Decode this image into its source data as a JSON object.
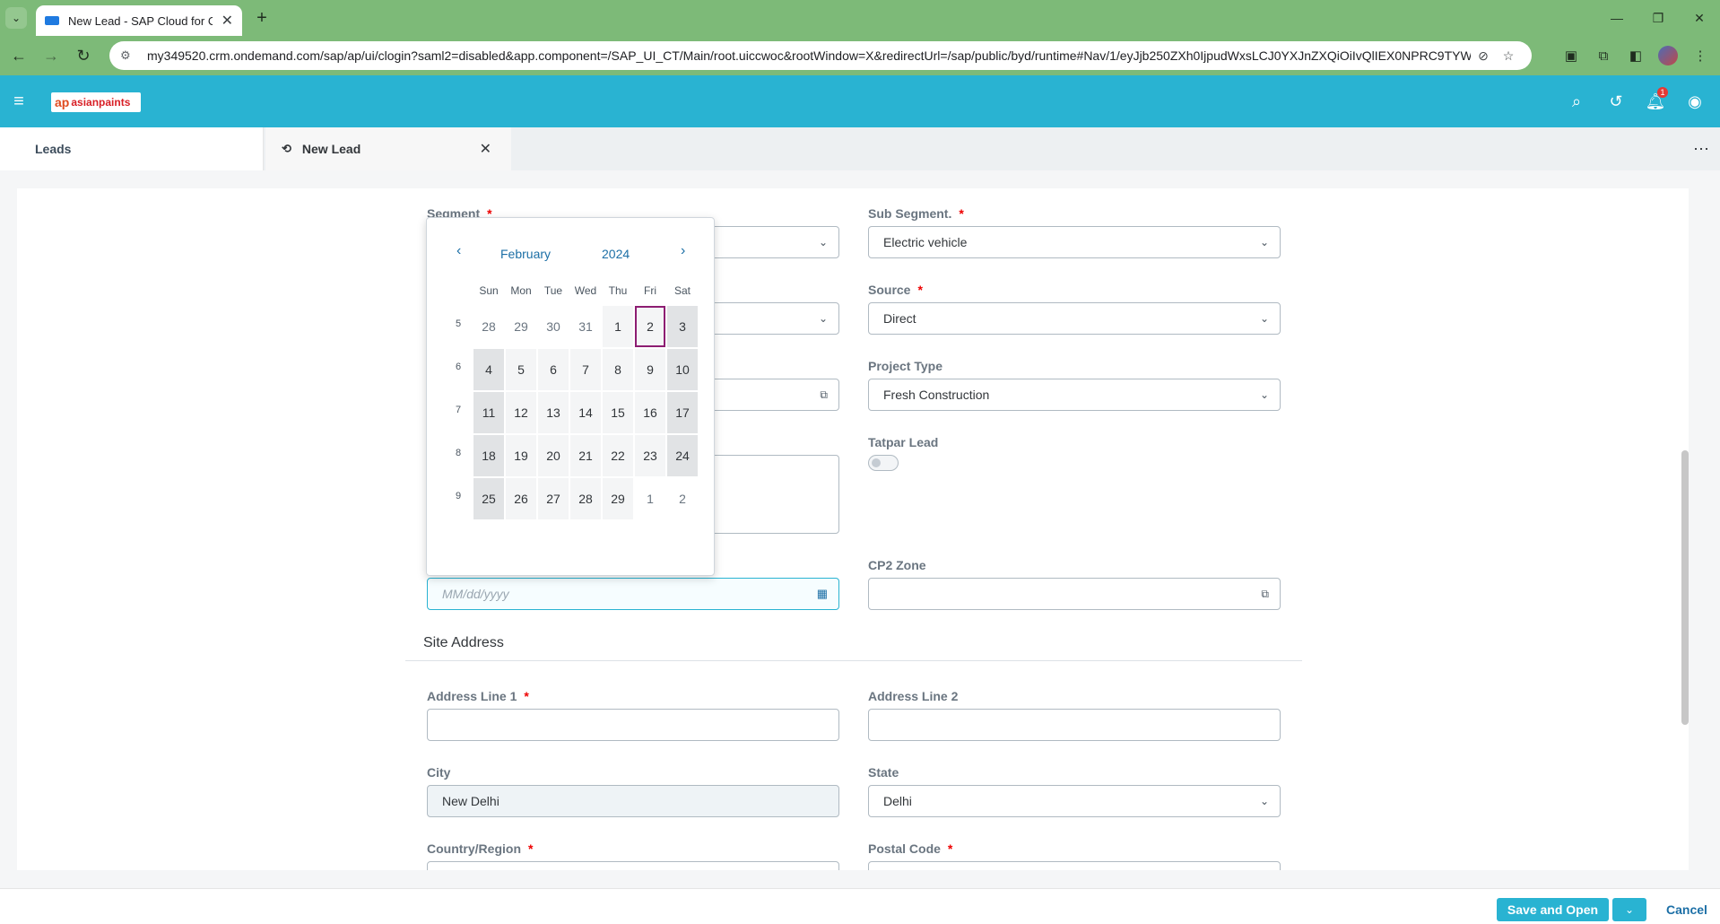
{
  "browser": {
    "tab_title": "New Lead - SAP Cloud for Cust",
    "url": "my349520.crm.ondemand.com/sap/ap/ui/clogin?saml2=disabled&app.component=/SAP_UI_CT/Main/root.uiccwoc&rootWindow=X&redirectUrl=/sap/public/byd/runtime#Nav/1/eyJjb250ZXh0IjpudWxsLCJ0YXJnZXQiOiIvQlIEX0NPRC9TYW..."
  },
  "shell": {
    "logo_text": "asianpaints",
    "notification_count": "1"
  },
  "tabs": {
    "leads": "Leads",
    "new_lead": "New Lead"
  },
  "form": {
    "segment": {
      "label": "Segment",
      "required": "*"
    },
    "sub_segment": {
      "label": "Sub Segment.",
      "required": "*",
      "value": "Electric vehicle"
    },
    "source": {
      "label": "Source",
      "required": "*",
      "value": "Direct"
    },
    "project_type": {
      "label": "Project Type",
      "value": "Fresh Construction"
    },
    "tatpar_lead": {
      "label": "Tatpar Lead",
      "checked": false
    },
    "date": {
      "placeholder": "MM/dd/yyyy"
    },
    "cp2_zone": {
      "label": "CP2 Zone",
      "value": ""
    },
    "site_address": {
      "title": "Site Address"
    },
    "address_line_1": {
      "label": "Address Line 1",
      "required": "*",
      "value": ""
    },
    "address_line_2": {
      "label": "Address Line 2",
      "value": ""
    },
    "city": {
      "label": "City",
      "value": "New Delhi"
    },
    "state": {
      "label": "State",
      "value": "Delhi"
    },
    "country_region": {
      "label": "Country/Region",
      "required": "*"
    },
    "postal_code": {
      "label": "Postal Code",
      "required": "*"
    }
  },
  "calendar": {
    "month": "February",
    "year": "2024",
    "weekdays": [
      "Sun",
      "Mon",
      "Tue",
      "Wed",
      "Thu",
      "Fri",
      "Sat"
    ],
    "weeks": [
      {
        "num": "5",
        "days": [
          "28",
          "29",
          "30",
          "31",
          "1",
          "2",
          "3"
        ]
      },
      {
        "num": "6",
        "days": [
          "4",
          "5",
          "6",
          "7",
          "8",
          "9",
          "10"
        ]
      },
      {
        "num": "7",
        "days": [
          "11",
          "12",
          "13",
          "14",
          "15",
          "16",
          "17"
        ]
      },
      {
        "num": "8",
        "days": [
          "18",
          "19",
          "20",
          "21",
          "22",
          "23",
          "24"
        ]
      },
      {
        "num": "9",
        "days": [
          "25",
          "26",
          "27",
          "28",
          "29",
          "1",
          "2"
        ]
      }
    ],
    "selected_day": "2"
  },
  "footer": {
    "save_and_open": "Save and Open",
    "cancel": "Cancel"
  }
}
